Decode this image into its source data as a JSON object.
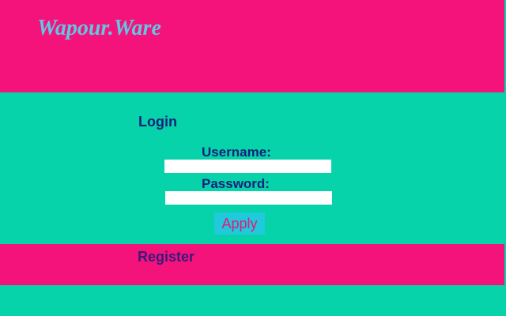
{
  "header": {
    "brand": "Wapour.Ware"
  },
  "login": {
    "title": "Login",
    "username_label": "Username:",
    "username_value": "",
    "password_label": "Password:",
    "password_value": "",
    "apply_label": "Apply"
  },
  "footer": {
    "register_label": "Register"
  },
  "colors": {
    "header_bg": "#f4137a",
    "body_bg": "#07d3aa",
    "brand_text": "#62c6e4",
    "label_text": "#15237a",
    "button_bg": "#20c9dc",
    "button_text": "#e4197c"
  }
}
